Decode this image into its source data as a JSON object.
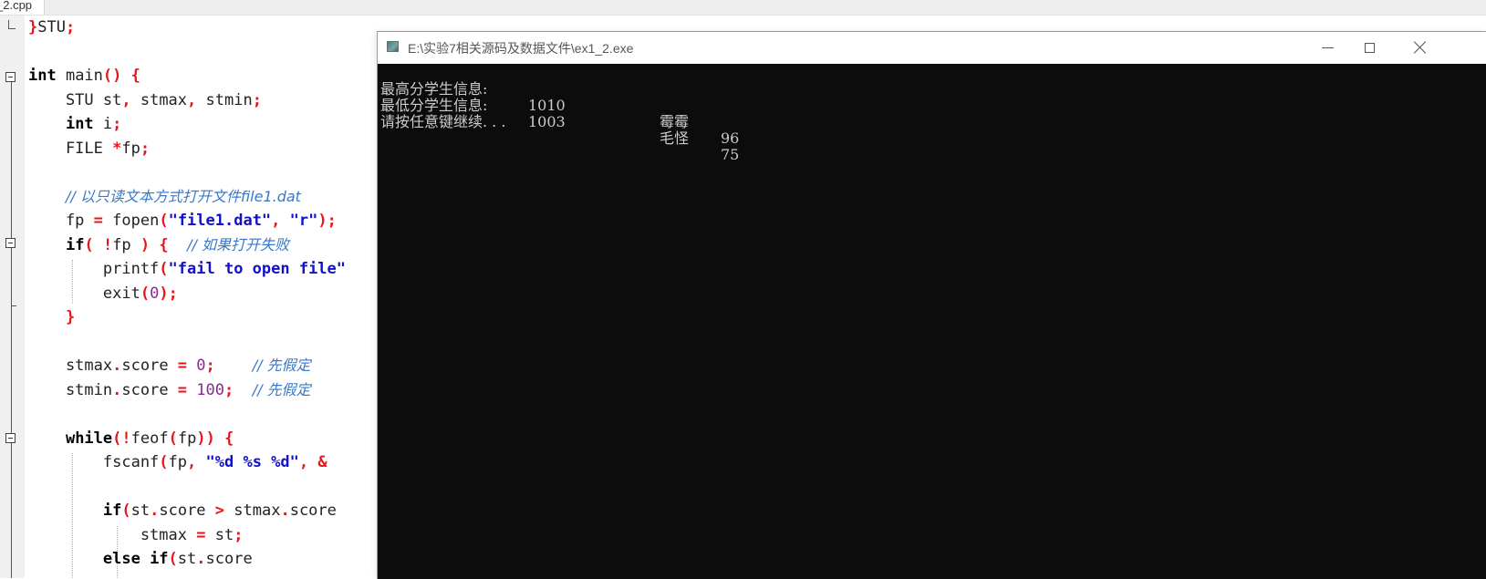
{
  "editor": {
    "tab_label": "_2.cpp",
    "lines": [
      [
        [
          "}",
          "pu"
        ],
        [
          "STU",
          ""
        ],
        [
          ";",
          "pu"
        ]
      ],
      [],
      [
        [
          "int",
          "kw"
        ],
        [
          " main",
          ""
        ],
        [
          "()",
          "pu"
        ],
        [
          " ",
          ""
        ],
        [
          "{",
          "pu"
        ]
      ],
      [
        [
          "    STU st",
          ""
        ],
        [
          ",",
          "pu"
        ],
        [
          " stmax",
          ""
        ],
        [
          ",",
          "pu"
        ],
        [
          " stmin",
          ""
        ],
        [
          ";",
          "pu"
        ]
      ],
      [
        [
          "    ",
          ""
        ],
        [
          "int",
          "kw"
        ],
        [
          " i",
          ""
        ],
        [
          ";",
          "pu"
        ]
      ],
      [
        [
          "    FILE ",
          ""
        ],
        [
          "*",
          "pu"
        ],
        [
          "fp",
          ""
        ],
        [
          ";",
          "pu"
        ]
      ],
      [],
      [
        [
          "    ",
          ""
        ],
        [
          "// 以只读文本方式打开文件file1.dat",
          "cm"
        ]
      ],
      [
        [
          "    fp ",
          ""
        ],
        [
          "=",
          "pu"
        ],
        [
          " fopen",
          ""
        ],
        [
          "(",
          "pu"
        ],
        [
          "\"file1.dat\"",
          "str"
        ],
        [
          ",",
          "pu"
        ],
        [
          " ",
          ""
        ],
        [
          "\"r\"",
          "str"
        ],
        [
          ");",
          "pu"
        ]
      ],
      [
        [
          "    ",
          ""
        ],
        [
          "if",
          "kw"
        ],
        [
          "(",
          "pu"
        ],
        [
          " ",
          ""
        ],
        [
          "!",
          "pu"
        ],
        [
          "fp ",
          ""
        ],
        [
          ")",
          "pu"
        ],
        [
          " ",
          ""
        ],
        [
          "{",
          "pu"
        ],
        [
          "  ",
          ""
        ],
        [
          "// 如果打开失败",
          "cm"
        ]
      ],
      [
        [
          "        printf",
          ""
        ],
        [
          "(",
          "pu"
        ],
        [
          "\"fail to open file\"",
          "str"
        ]
      ],
      [
        [
          "        exit",
          ""
        ],
        [
          "(",
          "pu"
        ],
        [
          "0",
          "num"
        ],
        [
          ");",
          "pu"
        ]
      ],
      [
        [
          "    ",
          ""
        ],
        [
          "}",
          "pu"
        ]
      ],
      [],
      [
        [
          "    stmax",
          ""
        ],
        [
          ".",
          "pu"
        ],
        [
          "score ",
          ""
        ],
        [
          "=",
          "pu"
        ],
        [
          " ",
          ""
        ],
        [
          "0",
          "num"
        ],
        [
          ";",
          "pu"
        ],
        [
          "    ",
          ""
        ],
        [
          "// 先假定",
          "cm"
        ]
      ],
      [
        [
          "    stmin",
          ""
        ],
        [
          ".",
          "pu"
        ],
        [
          "score ",
          ""
        ],
        [
          "=",
          "pu"
        ],
        [
          " ",
          ""
        ],
        [
          "100",
          "num"
        ],
        [
          ";",
          "pu"
        ],
        [
          "  ",
          ""
        ],
        [
          "// 先假定",
          "cm"
        ]
      ],
      [],
      [
        [
          "    ",
          ""
        ],
        [
          "while",
          "kw"
        ],
        [
          "(",
          "pu"
        ],
        [
          "!",
          "pu"
        ],
        [
          "feof",
          ""
        ],
        [
          "(",
          "pu"
        ],
        [
          "fp",
          ""
        ],
        [
          "))",
          "pu"
        ],
        [
          " ",
          ""
        ],
        [
          "{",
          "pu"
        ]
      ],
      [
        [
          "        fscanf",
          ""
        ],
        [
          "(",
          "pu"
        ],
        [
          "fp",
          ""
        ],
        [
          ",",
          "pu"
        ],
        [
          " ",
          ""
        ],
        [
          "\"%d %s %d\"",
          "str"
        ],
        [
          ",",
          "pu"
        ],
        [
          " ",
          ""
        ],
        [
          "&",
          "pu"
        ]
      ],
      [],
      [
        [
          "        ",
          ""
        ],
        [
          "if",
          "kw"
        ],
        [
          "(",
          "pu"
        ],
        [
          "st",
          ""
        ],
        [
          ".",
          "pu"
        ],
        [
          "score ",
          ""
        ],
        [
          ">",
          "pu"
        ],
        [
          " stmax",
          ""
        ],
        [
          ".",
          "pu"
        ],
        [
          "score",
          ""
        ]
      ],
      [
        [
          "            stmax ",
          ""
        ],
        [
          "=",
          "pu"
        ],
        [
          " st",
          ""
        ],
        [
          ";",
          "pu"
        ]
      ],
      [
        [
          "        ",
          ""
        ],
        [
          "else if",
          "kw"
        ],
        [
          "(",
          "pu"
        ],
        [
          "st",
          ""
        ],
        [
          ".",
          "pu"
        ],
        [
          "score",
          ""
        ]
      ]
    ]
  },
  "console": {
    "title": "E:\\实验7相关源码及数据文件\\ex1_2.exe",
    "lines": [
      {
        "label": "最高分学生信息:",
        "id": "1010",
        "name": "霉霉",
        "score": "96"
      },
      {
        "label": "最低分学生信息:",
        "id": "1003",
        "name": "毛怪",
        "score": "75"
      },
      {
        "label": "请按任意键继续. . .",
        "id": "",
        "name": "",
        "score": ""
      }
    ],
    "colors": {
      "background": "#0c0c0c",
      "text": "#cccccc"
    }
  },
  "syntax_colors": {
    "keyword": "#000000",
    "punctuation": "#e8151b",
    "string": "#1111c8",
    "number": "#8b2b8f",
    "comment": "#3a78c9"
  }
}
